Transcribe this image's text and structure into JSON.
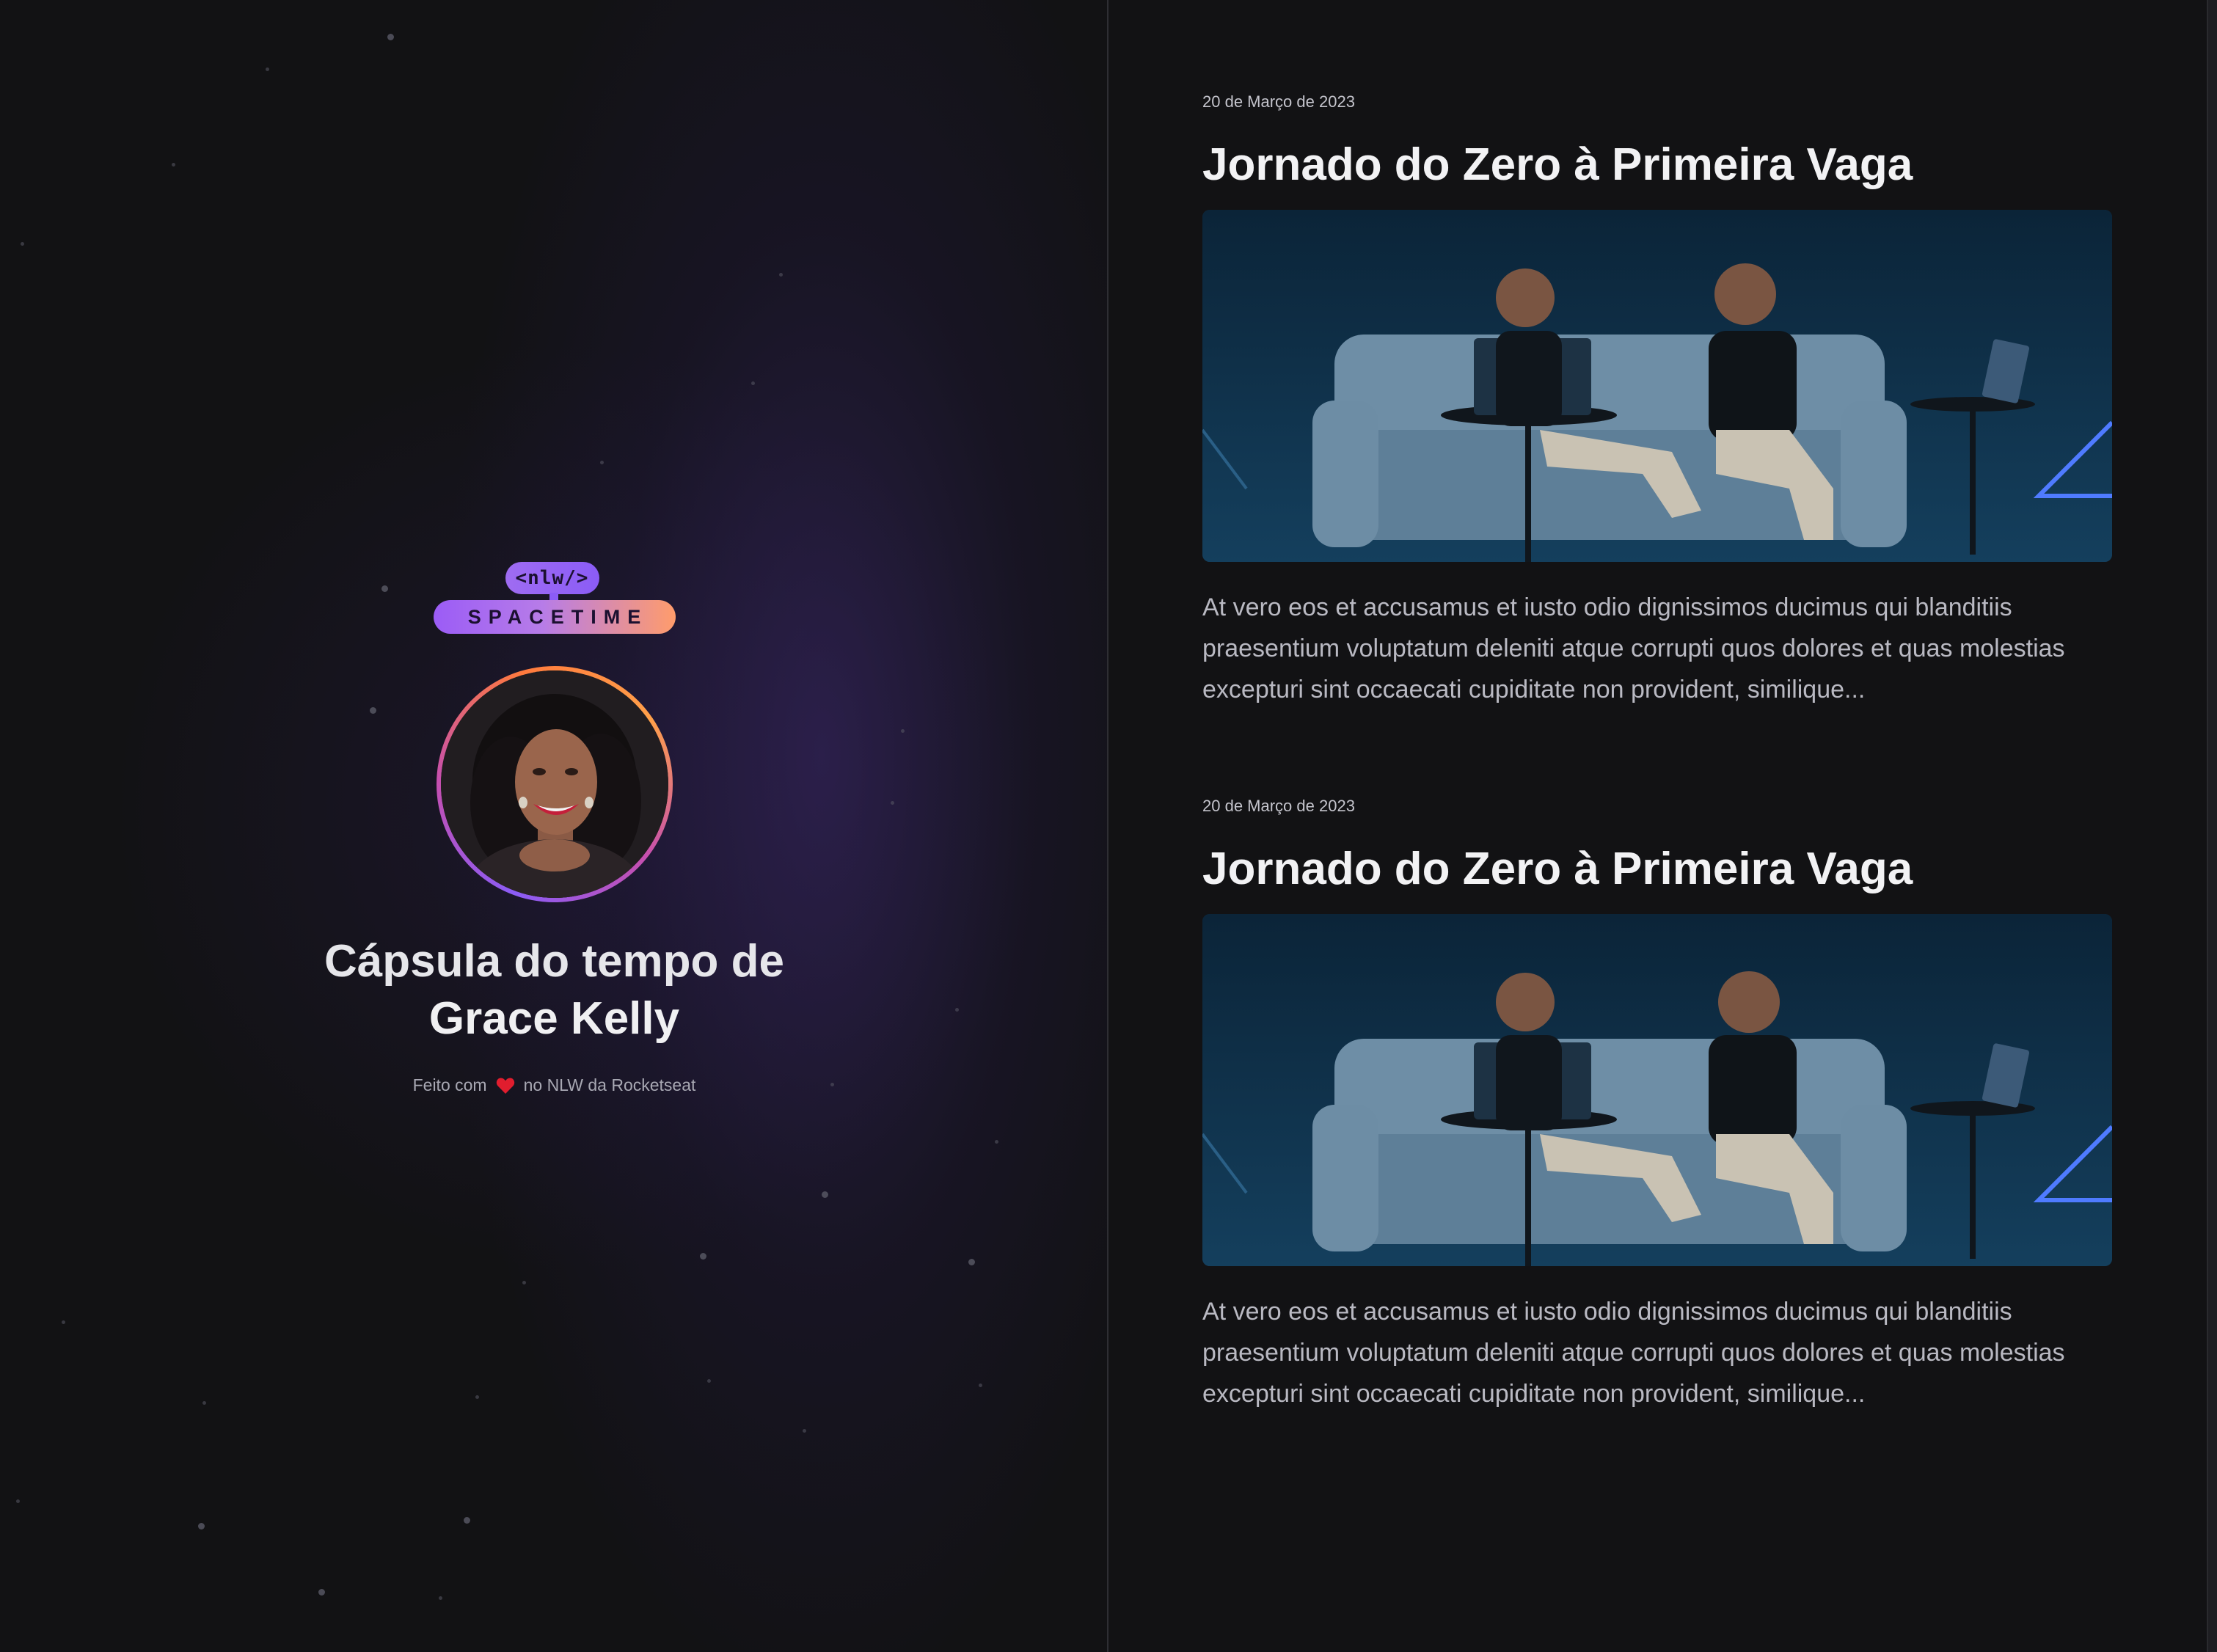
{
  "brand": {
    "tag_label": "<nlw/>",
    "name_label": "SPACETIME"
  },
  "profile": {
    "title_prefix": "Cápsula do tempo de",
    "name": "Grace Kelly"
  },
  "footer": {
    "made_prefix": "Feito com",
    "made_suffix": "no NLW da Rocketseat"
  },
  "memories": [
    {
      "date": "20 de Março de 2023",
      "title": "Jornado do Zero à Primeira Vaga",
      "excerpt": "At vero eos et accusamus et iusto odio dignissimos ducimus qui blanditiis praesentium voluptatum deleniti atque corrupti quos dolores et quas molestias excepturi sint occaecati cupiditate non provident, similique..."
    },
    {
      "date": "20 de Março de 2023",
      "title": "Jornado do Zero à Primeira Vaga",
      "excerpt": "At vero eos et accusamus et iusto odio dignissimos ducimus qui blanditiis praesentium voluptatum deleniti atque corrupti quos dolores et quas molestias excepturi sint occaecati cupiditate non provident, similique..."
    }
  ],
  "colors": {
    "background": "#121214",
    "accent_purple": "#8b5cf6",
    "accent_orange": "#ff9c6b",
    "heart": "#e11d2e"
  }
}
